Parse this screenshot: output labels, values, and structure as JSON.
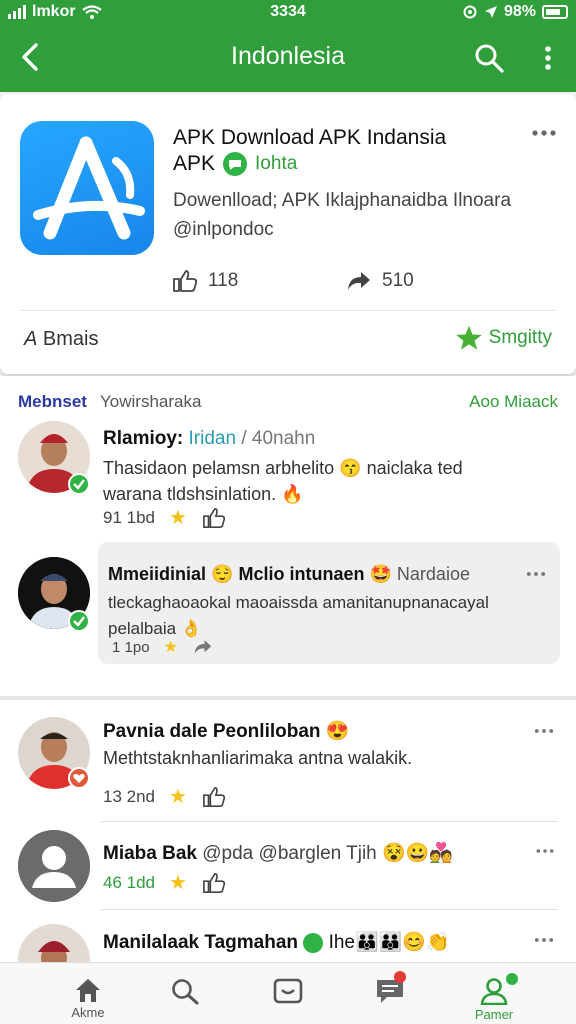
{
  "status_bar": {
    "carrier": "lmkor",
    "time": "3334",
    "battery": "98%"
  },
  "toolbar": {
    "title": "Indonlesia"
  },
  "app": {
    "name_line1": "APK Download APK Indansia",
    "name_line2": "APK",
    "tag": "Iohta",
    "description_line1": "Dowenlload; APK Iklajphanaidba Ilnoara",
    "description_line2": "@inlpondoc",
    "likes": "118",
    "shares": "510",
    "left_action": "Bmais",
    "right_action": "Smgitty"
  },
  "comments_header": {
    "left": "Mebnset",
    "middle": "Yowirsharaka",
    "right": "Aoo Miaack"
  },
  "comments": [
    {
      "name": "Rlamioy:",
      "name_tag": "Iridan",
      "time_suffix": "/ 40nahn",
      "text_line1": "Thasidaon pelamsn arbhelito",
      "text_emoji1": "😙",
      "text_line1b": "naiclaka ted",
      "text_line2": "warana tldshsinlation.",
      "text_emoji2": "🔥",
      "meta": "91 1bd"
    },
    {
      "name": "Mmeiidinial",
      "emoji_a": "😌",
      "name_b": "Mclio intunaen",
      "emoji_b": "🤩",
      "name_c": "Nardaioe",
      "text_line1": "tleckaghaoaokal maoaissda amanitanupnanacayal",
      "text_line2": "pelalbaia",
      "text_emoji": "👌",
      "meta": "1 1po"
    },
    {
      "name": "Pavnia dale Peonliloban",
      "emoji_a": "😍",
      "text": "Methtstaknhanliarimaka antna walakik.",
      "meta": "13 2nd"
    },
    {
      "name": "Miaba Bak",
      "handle": "@pda @barglen Tjih",
      "emoji_a": "😵😀💑",
      "meta": "46 1dd"
    },
    {
      "name": "Manilalaak Tagmahan",
      "tag": "Ihe",
      "emoji_a": "👪👪😊👏",
      "meta": ""
    }
  ],
  "bottom_nav": [
    {
      "label": "Akme"
    },
    {
      "label": ""
    },
    {
      "label": ""
    },
    {
      "label": ""
    },
    {
      "label": "Pamer"
    }
  ],
  "colors": {
    "brand_green": "#2f9e3b",
    "app_icon_blue": "#1d93f5",
    "star": "#f2c21b"
  }
}
